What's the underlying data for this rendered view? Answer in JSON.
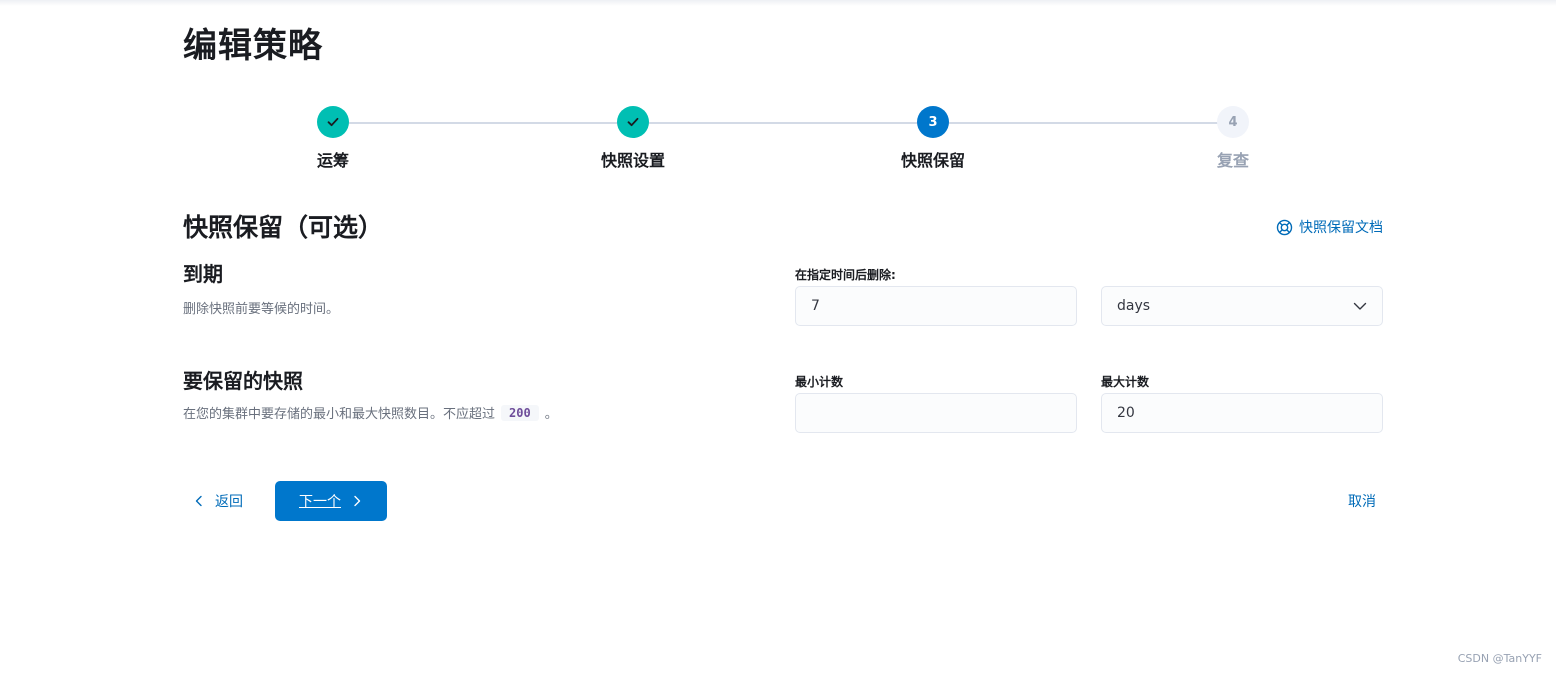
{
  "page": {
    "title": "编辑策略"
  },
  "stepper": {
    "steps": [
      {
        "label": "运筹",
        "status": "complete",
        "number": "1"
      },
      {
        "label": "快照设置",
        "status": "complete",
        "number": "2"
      },
      {
        "label": "快照保留",
        "status": "current",
        "number": "3"
      },
      {
        "label": "复查",
        "status": "incomplete",
        "number": "4"
      }
    ]
  },
  "section": {
    "title": "快照保留（可选）",
    "doc_link": "快照保留文档"
  },
  "expiration": {
    "title": "到期",
    "description": "删除快照前要等候的时间。",
    "field_label": "在指定时间后删除:",
    "value": "7",
    "unit": "days"
  },
  "retain": {
    "title": "要保留的快照",
    "description_prefix": "在您的集群中要存储的最小和最大快照数目。不应超过",
    "description_code": "200",
    "description_suffix": "。",
    "min_label": "最小计数",
    "min_value": "",
    "max_label": "最大计数",
    "max_value": "20"
  },
  "actions": {
    "back": "返回",
    "next": "下一个",
    "cancel": "取消"
  },
  "watermark": "CSDN @TanYYF",
  "colors": {
    "primary": "#0077cc",
    "success": "#00bfb3",
    "link": "#006bb8"
  }
}
